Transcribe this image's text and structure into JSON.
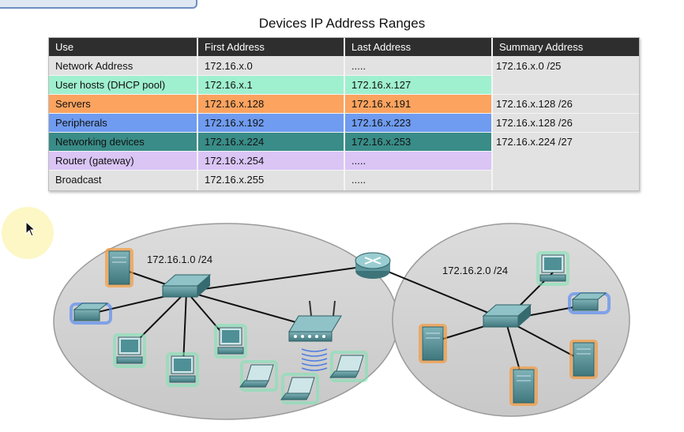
{
  "title": "Devices IP Address Ranges",
  "table": {
    "headers": [
      "Use",
      "First Address",
      "Last Address",
      "Summary Address"
    ],
    "rows": [
      {
        "use": "Network Address",
        "first": "172.16.x.0",
        "last": ".....",
        "color": "#e2e2e2"
      },
      {
        "use": "User hosts (DHCP pool)",
        "first": "172.16.x.1",
        "last": "172.16.x.127",
        "color": "#9ff0cf"
      },
      {
        "use": "Servers",
        "first": "172.16.x.128",
        "last": "172.16.x.191",
        "color": "#fba35f"
      },
      {
        "use": "Peripherals",
        "first": "172.16.x.192",
        "last": "172.16.x.223",
        "color": "#6f9bf0"
      },
      {
        "use": "Networking devices",
        "first": "172.16.x.224",
        "last": "172.16.x.253",
        "color": "#398c87"
      },
      {
        "use": "Router (gateway)",
        "first": "172.16.x.254",
        "last": ".....",
        "color": "#dac5f5"
      },
      {
        "use": "Broadcast",
        "first": "172.16.x.255",
        "last": ".....",
        "color": "#e2e2e2"
      }
    ],
    "summaries": [
      "172.16.x.0 /25",
      "172.16.x.128 /26",
      "172.16.x.128 /26",
      "172.16.x.224 /27"
    ]
  },
  "network": {
    "left_subnet": "172.16.1.0 /24",
    "right_subnet": "172.16.2.0 /24"
  },
  "colors": {
    "header": "#2e2e2e",
    "ellipse": "#d2d2d2",
    "device": "#4f8f96"
  },
  "icons": [
    "server-icon",
    "switch-icon",
    "router-icon",
    "printer-icon",
    "desktop-icon",
    "laptop-icon",
    "wireless-router-icon",
    "mouse-cursor-icon"
  ]
}
